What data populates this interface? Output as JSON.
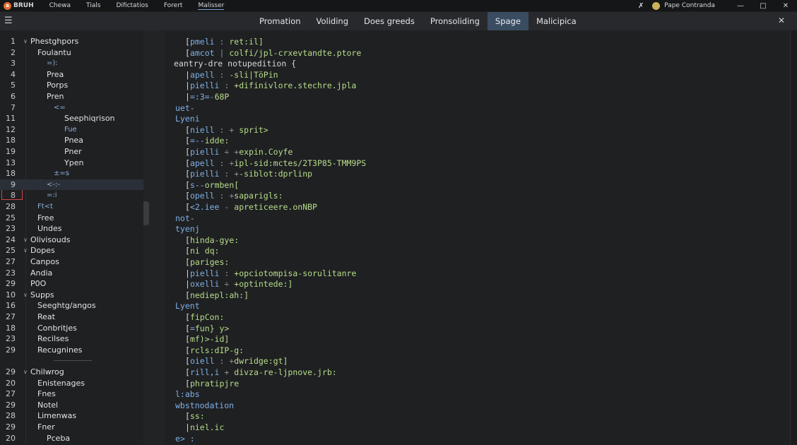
{
  "titlebar": {
    "app_name": "BRUH",
    "menus": [
      "Chewa",
      "Tials",
      "Difictatios",
      "Forert",
      "Malisser"
    ],
    "profile_label": "Pape Contranda"
  },
  "tabs": [
    "Promation",
    "Voliding",
    "Does greeds",
    "Pronsoliding",
    "Spage",
    "Malicipica"
  ],
  "active_tab": "Spage",
  "sidebar": {
    "rows": [
      {
        "n": "1",
        "label": "Phestghpors",
        "indent": 0,
        "caret": true
      },
      {
        "n": "2",
        "label": "Foulantu",
        "indent": 1
      },
      {
        "n": "3",
        "label": "=):",
        "indent": 2,
        "dim": true
      },
      {
        "n": "4",
        "label": "Prea",
        "indent": 2
      },
      {
        "n": "5",
        "label": "Porps",
        "indent": 2
      },
      {
        "n": "6",
        "label": "Pren",
        "indent": 2
      },
      {
        "n": "7",
        "label": "<=",
        "indent": 3,
        "dim": true
      },
      {
        "n": "11",
        "label": "Seephiqrison",
        "indent": 4
      },
      {
        "n": "12",
        "label": "Fue",
        "indent": 4,
        "dim": true
      },
      {
        "n": "18",
        "label": "Pnea",
        "indent": 4
      },
      {
        "n": "19",
        "label": "Pner",
        "indent": 4
      },
      {
        "n": "13",
        "label": "Ypen",
        "indent": 4
      },
      {
        "n": "18",
        "label": "±=s",
        "indent": 3,
        "dim": true
      },
      {
        "n": "9",
        "label": "<-:-",
        "indent": 2,
        "dim": true,
        "sel": true
      },
      {
        "n": "8",
        "label": "=:i",
        "indent": 2,
        "dim": true
      },
      {
        "n": "28",
        "label": "Ft<t",
        "indent": 1,
        "dim": true
      },
      {
        "n": "25",
        "label": "Free",
        "indent": 1
      },
      {
        "n": "23",
        "label": "Undes",
        "indent": 1
      },
      {
        "n": "24",
        "label": "Olivisouds",
        "indent": 0,
        "caret": true
      },
      {
        "n": "25",
        "label": "Dopes",
        "indent": 0,
        "caret": true
      },
      {
        "n": "27",
        "label": "Canpos",
        "indent": 0
      },
      {
        "n": "23",
        "label": "Andia",
        "indent": 0
      },
      {
        "n": "29",
        "label": "P0O",
        "indent": 0
      },
      {
        "n": "10",
        "label": "Supps",
        "indent": 0,
        "caret": true
      },
      {
        "n": "16",
        "label": "Seeghtg/angos",
        "indent": 1
      },
      {
        "n": "27",
        "label": "Reat",
        "indent": 1
      },
      {
        "n": "18",
        "label": "Conbritjes",
        "indent": 1
      },
      {
        "n": "23",
        "label": "Recilses",
        "indent": 1
      },
      {
        "n": "29",
        "label": "Recugnines",
        "indent": 1
      },
      {
        "n": "",
        "label": "",
        "indent": 0,
        "divider": true
      },
      {
        "n": "29",
        "label": "Chilwrog",
        "indent": 0,
        "caret": true
      },
      {
        "n": "20",
        "label": "Enistenages",
        "indent": 1
      },
      {
        "n": "27",
        "label": "Fnes",
        "indent": 1
      },
      {
        "n": "29",
        "label": "Notel",
        "indent": 1
      },
      {
        "n": "28",
        "label": "Limenwas",
        "indent": 1
      },
      {
        "n": "29",
        "label": "Fner",
        "indent": 1
      },
      {
        "n": "20",
        "label": "Pceba",
        "indent": 2
      }
    ]
  },
  "editor": {
    "lines": [
      {
        "i": 1,
        "o": "[",
        "k": "pmeli",
        "s": " : ",
        "v": "ret:il]"
      },
      {
        "i": 1,
        "o": "[",
        "k": "amcot",
        "s": " | ",
        "v": "colfi/jpl-crxevtandte.ptore"
      },
      {
        "i": 0,
        "o": "",
        "k": "",
        "s": "",
        "v": "",
        "p": "eantry-dre notupedition {"
      },
      {
        "i": 1,
        "o": "|",
        "k": "apell",
        "s": " : ",
        "v": "-sli|TöPin"
      },
      {
        "i": 1,
        "o": "|",
        "k": "pielli",
        "s": " : ",
        "v": "+difinivlore.stechre.jpla"
      },
      {
        "i": 1,
        "o": "|",
        "k": "=:3=",
        "s": "-",
        "v": "68P"
      },
      {
        "i": 0,
        "o": "",
        "k": "",
        "s": "",
        "v": "",
        "h": "uet-"
      },
      {
        "i": 0,
        "o": "",
        "k": "",
        "s": "",
        "v": "",
        "h": "Lyeni"
      },
      {
        "i": 1,
        "o": "[",
        "k": "niell",
        "s": " : + ",
        "v": "sprit>"
      },
      {
        "i": 1,
        "o": "[",
        "k": "=--",
        "s": "",
        "v": "idde:"
      },
      {
        "i": 1,
        "o": "[",
        "k": "pielli",
        "s": " ÷ +",
        "v": "expin.Coyfe"
      },
      {
        "i": 1,
        "o": "[",
        "k": "apell",
        "s": " : +",
        "v": "ipl-sid:mctes/2T3P85-TMM9PS"
      },
      {
        "i": 1,
        "o": "[",
        "k": "pielli",
        "s": " : +",
        "v": "-siblot:dprlinp"
      },
      {
        "i": 1,
        "o": "[",
        "k": "s--",
        "s": "",
        "v": "ormben["
      },
      {
        "i": 1,
        "o": "[",
        "k": "opell",
        "s": " : +",
        "v": "saparigls:"
      },
      {
        "i": 1,
        "o": "[",
        "k": "<2.iee",
        "s": " - ",
        "v": "apreticeere.onNBP"
      },
      {
        "i": 0,
        "o": "",
        "k": "",
        "s": "",
        "v": "",
        "h": "not-"
      },
      {
        "i": 0,
        "o": "",
        "k": "",
        "s": "",
        "v": "",
        "h": "tyenj"
      },
      {
        "i": 1,
        "o": "[",
        "k": "",
        "s": "",
        "v": "hinda-gye:"
      },
      {
        "i": 1,
        "o": "[",
        "k": "",
        "s": "",
        "v": "ni dq:"
      },
      {
        "i": 1,
        "o": "[",
        "k": "",
        "s": "",
        "v": "pariges:"
      },
      {
        "i": 1,
        "o": "|",
        "k": "pielli",
        "s": " : ",
        "v": "+opciotompisa-sorulitanre"
      },
      {
        "i": 1,
        "o": "|",
        "k": "oxelli",
        "s": " ÷ ",
        "v": "+optintede:]"
      },
      {
        "i": 1,
        "o": "[",
        "k": "",
        "s": "",
        "v": "nediepl:ah:]"
      },
      {
        "i": 0,
        "o": "",
        "k": "",
        "s": "",
        "v": "",
        "h": "Lyent"
      },
      {
        "i": 1,
        "o": "[",
        "k": "",
        "s": "",
        "v": "fipCon:"
      },
      {
        "i": 1,
        "o": "[",
        "k": "=",
        "s": "",
        "v": "fun} y>"
      },
      {
        "i": 1,
        "o": "[",
        "k": "",
        "s": "",
        "v": "mf)>-id]"
      },
      {
        "i": 1,
        "o": "[",
        "k": "",
        "s": "",
        "v": "rcls:dIP-g:"
      },
      {
        "i": 1,
        "o": "[",
        "k": "oiell",
        "s": " : +",
        "v": "dwridge:gt]"
      },
      {
        "i": 1,
        "o": "[",
        "k": "rill,i",
        "s": " + ",
        "v": "divza-re-ljpnove.jrb:"
      },
      {
        "i": 1,
        "o": "[",
        "k": "",
        "s": "",
        "v": "phratipjre"
      },
      {
        "i": 0,
        "o": "",
        "k": "",
        "s": "",
        "v": "",
        "h": "l:abs"
      },
      {
        "i": 0,
        "o": "",
        "k": "",
        "s": "",
        "v": "",
        "h": "wbstnodation"
      },
      {
        "i": 1,
        "o": "[",
        "k": "",
        "s": "",
        "v": "ss:"
      },
      {
        "i": 1,
        "o": "|",
        "k": "",
        "s": "",
        "v": "niel.ic"
      },
      {
        "i": 0,
        "o": "",
        "k": "",
        "s": "",
        "v": "",
        "h": "e> :"
      }
    ]
  },
  "colors": {
    "accent": "#3a4c60",
    "key": "#7fb1e6",
    "value": "#b7dd8a",
    "marker": "#d24545"
  }
}
